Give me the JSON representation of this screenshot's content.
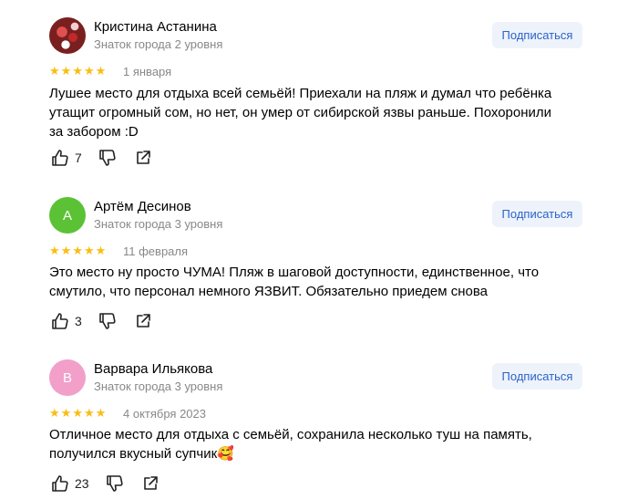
{
  "reviews": [
    {
      "name": "Кристина Астанина",
      "level": "Знаток города 2 уровня",
      "avatar": {
        "type": "photo",
        "letter": "",
        "color": "#7a1f1f"
      },
      "subscribe_label": "Подписаться",
      "rating": 5,
      "date": "1 января",
      "text": "Лушее место для отдыха всей семьёй! Приехали на пляж и думал что ребёнка утащит огромный сом, но нет, он умер от сибирской язвы раньше. Похоронили за забором :D",
      "likes": "7"
    },
    {
      "name": "Артём Десинов",
      "level": "Знаток города 3 уровня",
      "avatar": {
        "type": "letter",
        "letter": "А",
        "color": "#5bc236"
      },
      "subscribe_label": "Подписаться",
      "rating": 5,
      "date": "11 февраля",
      "text": "Это место ну просто ЧУМА! Пляж в шаговой доступности, единственное, что смутило, что персонал немного ЯЗВИТ. Обязательно приедем снова",
      "likes": "3"
    },
    {
      "name": "Варвара Ильякова",
      "level": "Знаток города 3 уровня",
      "avatar": {
        "type": "letter",
        "letter": "В",
        "color": "#f29fca"
      },
      "subscribe_label": "Подписаться",
      "rating": 5,
      "date": "4 октября 2023",
      "text": "Отличное место для отдыха с семьёй, сохранила несколько туш на память, получился вкусный супчик🥰",
      "likes": "23"
    }
  ],
  "colors": {
    "star": "#fbbd12",
    "subscribe_bg": "#eef3fb",
    "subscribe_text": "#2b62c8",
    "secondary_text": "#888888"
  },
  "icons": [
    "like-icon",
    "dislike-icon",
    "share-icon",
    "star-icon"
  ]
}
